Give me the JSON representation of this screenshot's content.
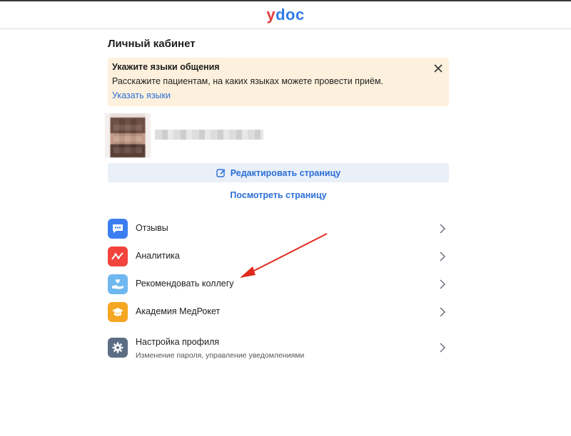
{
  "header": {
    "logo_y": "y",
    "logo_doc": "doc"
  },
  "page": {
    "title": "Личный кабинет"
  },
  "notice": {
    "title": "Укажите языки общения",
    "text": "Расскажите пациентам, на каких языках можете провести приём.",
    "link": "Указать языки"
  },
  "profile": {
    "edit_button": "Редактировать страницу",
    "view_link": "Посмотреть страницу"
  },
  "menu": {
    "items": [
      {
        "label": "Отзывы",
        "icon": "chat-bubble-icon",
        "color": "#3c7ef0"
      },
      {
        "label": "Аналитика",
        "icon": "analytics-icon",
        "color": "#f2443d"
      },
      {
        "label": "Рекомендовать коллегу",
        "icon": "recommend-hand-icon",
        "color": "#6fb8ef"
      },
      {
        "label": "Академия МедРокет",
        "icon": "graduation-cap-icon",
        "color": "#f5a623"
      },
      {
        "label": "Настройка профиля",
        "sub": "Изменение пароля, управление уведомлениями",
        "icon": "gear-icon",
        "color": "#5b6e84"
      }
    ]
  },
  "colors": {
    "accent": "#2b6fd6",
    "notice_bg": "#fdf1dd",
    "annotation_arrow": "#e02a1f"
  }
}
